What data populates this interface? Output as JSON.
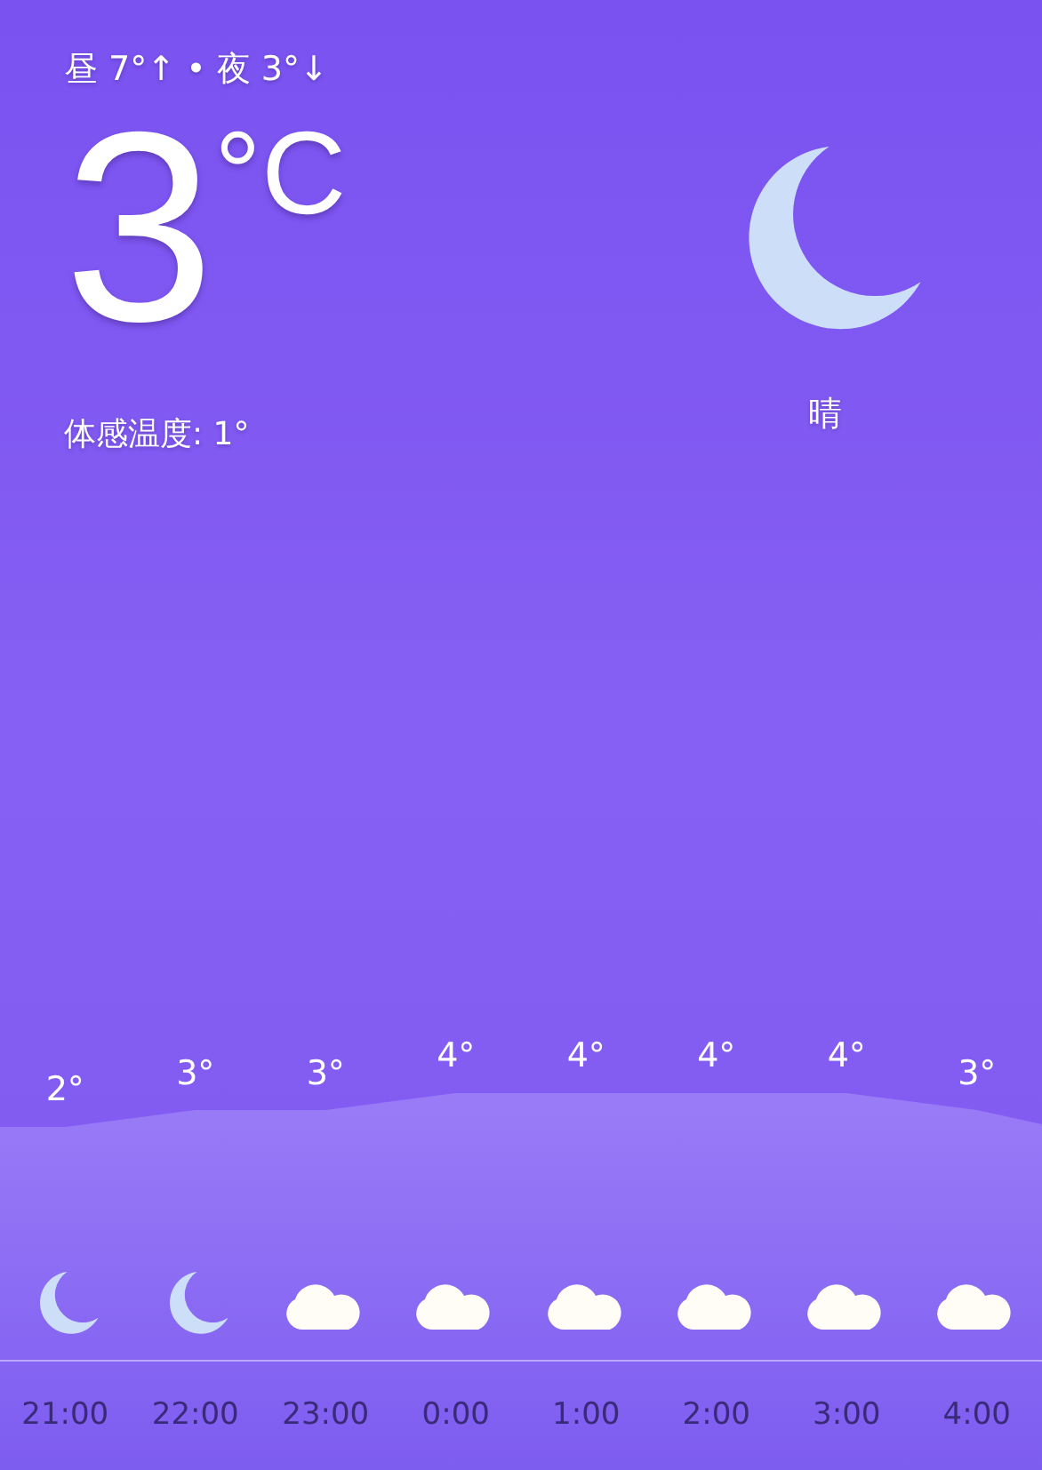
{
  "header": {
    "day_night": "昼 7°↑ • 夜 3°↓",
    "temperature": "3",
    "unit": "°C",
    "feels_like": "体感温度: 1°",
    "condition": "晴",
    "kind": "moon"
  },
  "hourly": [
    {
      "temp": "2°",
      "kind": "moon",
      "time": "21:00"
    },
    {
      "temp": "3°",
      "kind": "moon",
      "time": "22:00"
    },
    {
      "temp": "3°",
      "kind": "cloud",
      "time": "23:00"
    },
    {
      "temp": "4°",
      "kind": "cloud",
      "time": "0:00"
    },
    {
      "temp": "4°",
      "kind": "cloud",
      "time": "1:00"
    },
    {
      "temp": "4°",
      "kind": "cloud",
      "time": "2:00"
    },
    {
      "temp": "4°",
      "kind": "cloud",
      "time": "3:00"
    },
    {
      "temp": "3°",
      "kind": "cloud",
      "time": "4:00"
    }
  ]
}
